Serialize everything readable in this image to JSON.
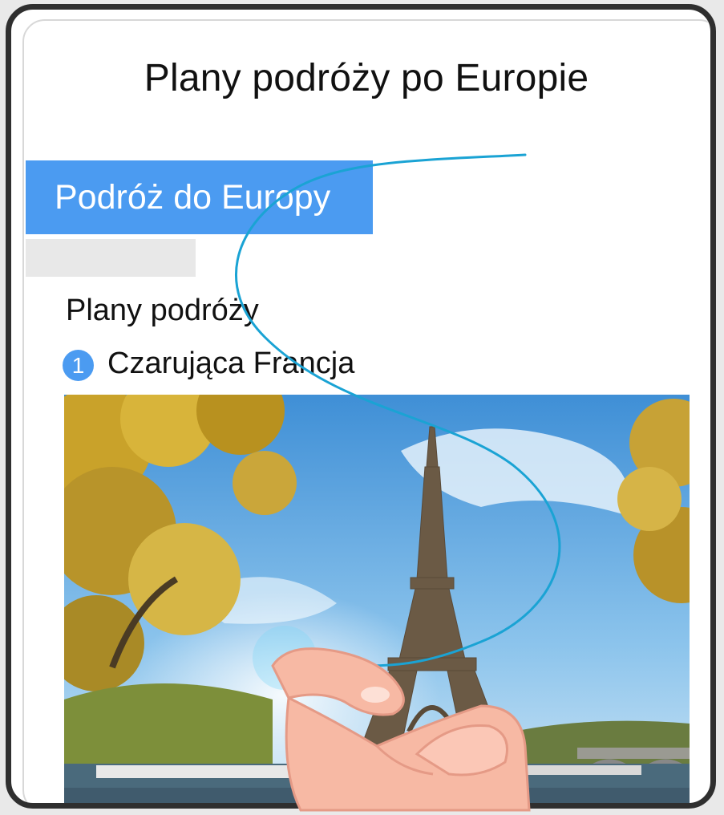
{
  "document": {
    "title": "Plany podróży po Europie",
    "section_banner": "Podróż do Europy",
    "subheading": "Plany podróży",
    "items": [
      {
        "number": "1",
        "label": "Czarująca Francja"
      }
    ]
  },
  "photo": {
    "subject": "Eiffel Tower and Seine river with autumn trees"
  },
  "gesture": {
    "type": "knuckle-draw-s-curve",
    "icon": "knuckle-hand-icon"
  },
  "colors": {
    "accent": "#4b9bf1",
    "gesture_trail": "#1aa3d4",
    "hand": "#f7b9a4"
  }
}
